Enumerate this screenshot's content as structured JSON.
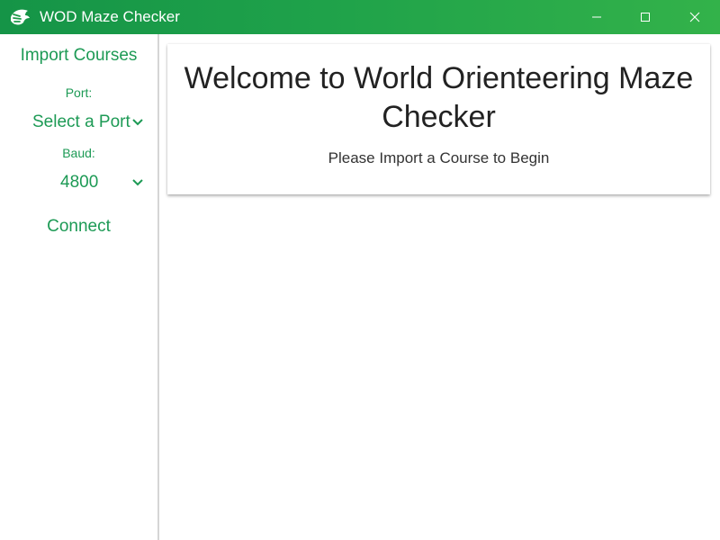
{
  "window": {
    "title": "WOD Maze Checker",
    "icons": {
      "app": "orienteering-logo-icon",
      "minimize": "minimize-icon",
      "maximize": "maximize-icon",
      "close": "close-icon"
    }
  },
  "sidebar": {
    "import_label": "Import Courses",
    "port_label": "Port:",
    "port_value": "Select a Port",
    "baud_label": "Baud:",
    "baud_value": "4800",
    "connect_label": "Connect"
  },
  "main": {
    "welcome_title": "Welcome to World Orienteering Maze Checker",
    "welcome_subtitle": "Please Import a Course to Begin"
  },
  "colors": {
    "titlebar_start": "#159447",
    "titlebar_end": "#33b24a",
    "accent": "#1d9a55"
  }
}
